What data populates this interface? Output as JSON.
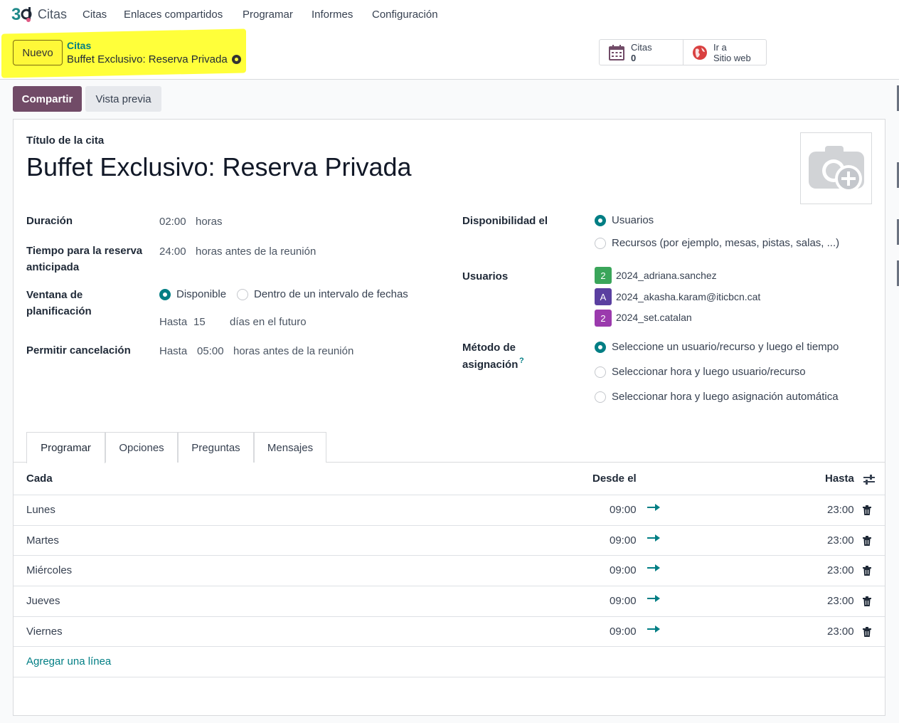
{
  "nav": {
    "app_name": "Citas",
    "items": [
      "Citas",
      "Enlaces compartidos",
      "Programar",
      "Informes",
      "Configuración"
    ]
  },
  "control": {
    "new_button": "Nuevo",
    "breadcrumb_parent": "Citas",
    "breadcrumb_current": "Buffet Exclusivo: Reserva Privada",
    "stat_citas_label": "Citas",
    "stat_citas_value": "0",
    "stat_web_line1": "Ir a",
    "stat_web_line2": "Sitio web"
  },
  "actions": {
    "share": "Compartir",
    "preview": "Vista previa"
  },
  "form": {
    "title_label": "Título de la cita",
    "title": "Buffet Exclusivo: Reserva Privada",
    "duration_label": "Duración",
    "duration_value": "02:00",
    "duration_unit": "horas",
    "lead_label_1": "Tiempo para la reserva",
    "lead_label_2": "anticipada",
    "lead_value": "24:00",
    "lead_unit": "horas antes de la reunión",
    "window_label_1": "Ventana de",
    "window_label_2": "planificación",
    "window_opt1": "Disponible",
    "window_opt2": "Dentro de un intervalo de fechas",
    "window_until": "Hasta",
    "window_days": "15",
    "window_days_unit": "días en el futuro",
    "cancel_label": "Permitir cancelación",
    "cancel_until": "Hasta",
    "cancel_value": "05:00",
    "cancel_unit": "horas antes de la reunión",
    "avail_label": "Disponibilidad el",
    "avail_opt1": "Usuarios",
    "avail_opt2": "Recursos (por ejemplo, mesas, pistas, salas, ...)",
    "users_label": "Usuarios",
    "users": [
      {
        "initial": "2",
        "name": "2024_adriana.sanchez",
        "color": "#3aa55a"
      },
      {
        "initial": "A",
        "name": "2024_akasha.karam@iticbcn.cat",
        "color": "#5a3fa0"
      },
      {
        "initial": "2",
        "name": "2024_set.catalan",
        "color": "#9b3aad"
      }
    ],
    "assign_label_1": "Método de",
    "assign_label_2": "asignación",
    "assign_help": "?",
    "assign_opt1": "Seleccione un usuario/recurso y luego el tiempo",
    "assign_opt2": "Seleccionar hora y luego usuario/recurso",
    "assign_opt3": "Seleccionar hora y luego asignación automática"
  },
  "tabs": [
    "Programar",
    "Opciones",
    "Preguntas",
    "Mensajes"
  ],
  "table": {
    "headers": {
      "day": "Cada",
      "from": "Desde el",
      "to": "Hasta"
    },
    "rows": [
      {
        "day": "Lunes",
        "from": "09:00",
        "to": "23:00"
      },
      {
        "day": "Martes",
        "from": "09:00",
        "to": "23:00"
      },
      {
        "day": "Miércoles",
        "from": "09:00",
        "to": "23:00"
      },
      {
        "day": "Jueves",
        "from": "09:00",
        "to": "23:00"
      },
      {
        "day": "Viernes",
        "from": "09:00",
        "to": "23:00"
      }
    ],
    "add_line": "Agregar una línea"
  },
  "colors": {
    "primary": "#714b67",
    "accent": "#017e84",
    "highlight": "#ffff3a"
  },
  "icons": [
    "app-logo-icon",
    "gear-icon",
    "calendar-icon",
    "globe-icon",
    "camera-plus-icon",
    "settings-sliders-icon",
    "arrow-right-icon",
    "trash-icon"
  ]
}
